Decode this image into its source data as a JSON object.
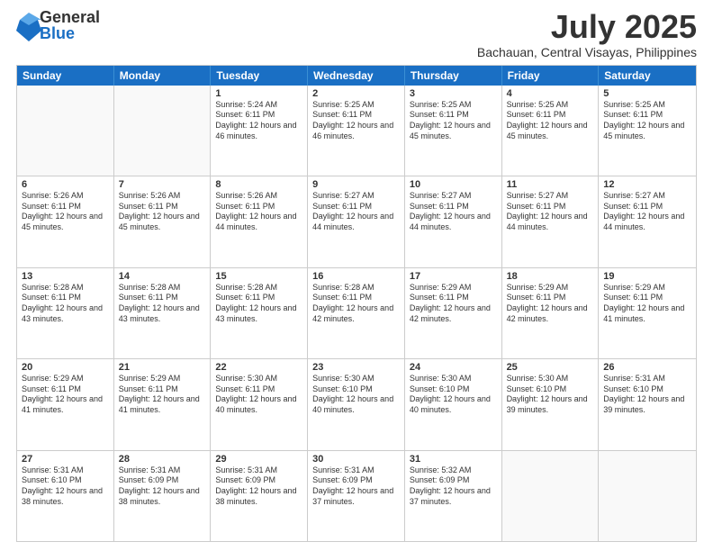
{
  "logo": {
    "general": "General",
    "blue": "Blue"
  },
  "title": "July 2025",
  "subtitle": "Bachauan, Central Visayas, Philippines",
  "header_days": [
    "Sunday",
    "Monday",
    "Tuesday",
    "Wednesday",
    "Thursday",
    "Friday",
    "Saturday"
  ],
  "weeks": [
    [
      {
        "day": "",
        "info": "",
        "empty": true
      },
      {
        "day": "",
        "info": "",
        "empty": true
      },
      {
        "day": "1",
        "info": "Sunrise: 5:24 AM\nSunset: 6:11 PM\nDaylight: 12 hours and 46 minutes."
      },
      {
        "day": "2",
        "info": "Sunrise: 5:25 AM\nSunset: 6:11 PM\nDaylight: 12 hours and 46 minutes."
      },
      {
        "day": "3",
        "info": "Sunrise: 5:25 AM\nSunset: 6:11 PM\nDaylight: 12 hours and 45 minutes."
      },
      {
        "day": "4",
        "info": "Sunrise: 5:25 AM\nSunset: 6:11 PM\nDaylight: 12 hours and 45 minutes."
      },
      {
        "day": "5",
        "info": "Sunrise: 5:25 AM\nSunset: 6:11 PM\nDaylight: 12 hours and 45 minutes."
      }
    ],
    [
      {
        "day": "6",
        "info": "Sunrise: 5:26 AM\nSunset: 6:11 PM\nDaylight: 12 hours and 45 minutes."
      },
      {
        "day": "7",
        "info": "Sunrise: 5:26 AM\nSunset: 6:11 PM\nDaylight: 12 hours and 45 minutes."
      },
      {
        "day": "8",
        "info": "Sunrise: 5:26 AM\nSunset: 6:11 PM\nDaylight: 12 hours and 44 minutes."
      },
      {
        "day": "9",
        "info": "Sunrise: 5:27 AM\nSunset: 6:11 PM\nDaylight: 12 hours and 44 minutes."
      },
      {
        "day": "10",
        "info": "Sunrise: 5:27 AM\nSunset: 6:11 PM\nDaylight: 12 hours and 44 minutes."
      },
      {
        "day": "11",
        "info": "Sunrise: 5:27 AM\nSunset: 6:11 PM\nDaylight: 12 hours and 44 minutes."
      },
      {
        "day": "12",
        "info": "Sunrise: 5:27 AM\nSunset: 6:11 PM\nDaylight: 12 hours and 44 minutes."
      }
    ],
    [
      {
        "day": "13",
        "info": "Sunrise: 5:28 AM\nSunset: 6:11 PM\nDaylight: 12 hours and 43 minutes."
      },
      {
        "day": "14",
        "info": "Sunrise: 5:28 AM\nSunset: 6:11 PM\nDaylight: 12 hours and 43 minutes."
      },
      {
        "day": "15",
        "info": "Sunrise: 5:28 AM\nSunset: 6:11 PM\nDaylight: 12 hours and 43 minutes."
      },
      {
        "day": "16",
        "info": "Sunrise: 5:28 AM\nSunset: 6:11 PM\nDaylight: 12 hours and 42 minutes."
      },
      {
        "day": "17",
        "info": "Sunrise: 5:29 AM\nSunset: 6:11 PM\nDaylight: 12 hours and 42 minutes."
      },
      {
        "day": "18",
        "info": "Sunrise: 5:29 AM\nSunset: 6:11 PM\nDaylight: 12 hours and 42 minutes."
      },
      {
        "day": "19",
        "info": "Sunrise: 5:29 AM\nSunset: 6:11 PM\nDaylight: 12 hours and 41 minutes."
      }
    ],
    [
      {
        "day": "20",
        "info": "Sunrise: 5:29 AM\nSunset: 6:11 PM\nDaylight: 12 hours and 41 minutes."
      },
      {
        "day": "21",
        "info": "Sunrise: 5:29 AM\nSunset: 6:11 PM\nDaylight: 12 hours and 41 minutes."
      },
      {
        "day": "22",
        "info": "Sunrise: 5:30 AM\nSunset: 6:11 PM\nDaylight: 12 hours and 40 minutes."
      },
      {
        "day": "23",
        "info": "Sunrise: 5:30 AM\nSunset: 6:10 PM\nDaylight: 12 hours and 40 minutes."
      },
      {
        "day": "24",
        "info": "Sunrise: 5:30 AM\nSunset: 6:10 PM\nDaylight: 12 hours and 40 minutes."
      },
      {
        "day": "25",
        "info": "Sunrise: 5:30 AM\nSunset: 6:10 PM\nDaylight: 12 hours and 39 minutes."
      },
      {
        "day": "26",
        "info": "Sunrise: 5:31 AM\nSunset: 6:10 PM\nDaylight: 12 hours and 39 minutes."
      }
    ],
    [
      {
        "day": "27",
        "info": "Sunrise: 5:31 AM\nSunset: 6:10 PM\nDaylight: 12 hours and 38 minutes."
      },
      {
        "day": "28",
        "info": "Sunrise: 5:31 AM\nSunset: 6:09 PM\nDaylight: 12 hours and 38 minutes."
      },
      {
        "day": "29",
        "info": "Sunrise: 5:31 AM\nSunset: 6:09 PM\nDaylight: 12 hours and 38 minutes."
      },
      {
        "day": "30",
        "info": "Sunrise: 5:31 AM\nSunset: 6:09 PM\nDaylight: 12 hours and 37 minutes."
      },
      {
        "day": "31",
        "info": "Sunrise: 5:32 AM\nSunset: 6:09 PM\nDaylight: 12 hours and 37 minutes."
      },
      {
        "day": "",
        "info": "",
        "empty": true
      },
      {
        "day": "",
        "info": "",
        "empty": true
      }
    ]
  ]
}
